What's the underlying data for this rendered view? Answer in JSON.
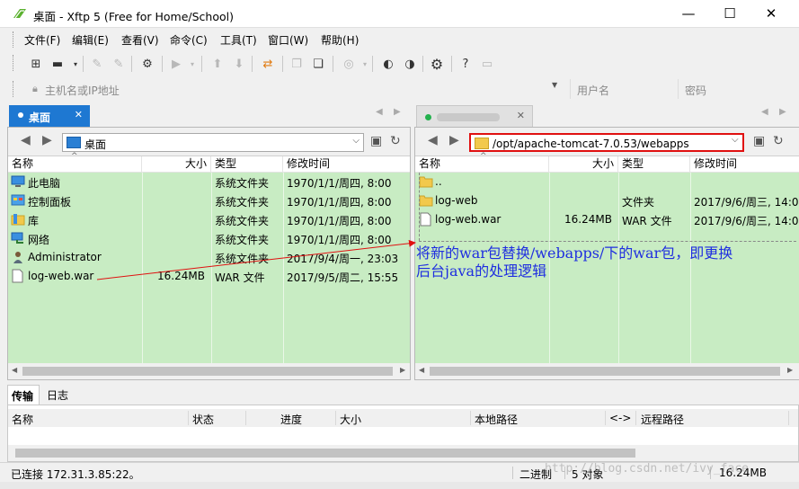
{
  "window": {
    "title": "桌面 - Xftp 5 (Free for Home/School)",
    "minimize": "—",
    "maximize": "☐",
    "close": "✕"
  },
  "menu": [
    "文件(F)",
    "编辑(E)",
    "查看(V)",
    "命令(C)",
    "工具(T)",
    "窗口(W)",
    "帮助(H)"
  ],
  "addressbar": {
    "host_placeholder": "主机名或IP地址",
    "user_placeholder": "用户名",
    "password_placeholder": "密码"
  },
  "left": {
    "tab_label": "桌面",
    "path": "桌面",
    "columns": {
      "name": "名称",
      "size": "大小",
      "type": "类型",
      "modified": "修改时间"
    },
    "files": [
      {
        "name": "此电脑",
        "size": "",
        "type": "系统文件夹",
        "modified": "1970/1/1/周四, 8:00",
        "icon": "computer-icon"
      },
      {
        "name": "控制面板",
        "size": "",
        "type": "系统文件夹",
        "modified": "1970/1/1/周四, 8:00",
        "icon": "control-panel-icon"
      },
      {
        "name": "库",
        "size": "",
        "type": "系统文件夹",
        "modified": "1970/1/1/周四, 8:00",
        "icon": "library-icon"
      },
      {
        "name": "网络",
        "size": "",
        "type": "系统文件夹",
        "modified": "1970/1/1/周四, 8:00",
        "icon": "network-icon"
      },
      {
        "name": "Administrator",
        "size": "",
        "type": "系统文件夹",
        "modified": "2017/9/4/周一, 23:03",
        "icon": "user-icon"
      },
      {
        "name": "log-web.war",
        "size": "16.24MB",
        "type": "WAR 文件",
        "modified": "2017/9/5/周二, 15:55",
        "icon": "file-icon"
      }
    ]
  },
  "right": {
    "path": "/opt/apache-tomcat-7.0.53/webapps",
    "columns": {
      "name": "名称",
      "size": "大小",
      "type": "类型",
      "modified": "修改时间"
    },
    "files": [
      {
        "name": "..",
        "size": "",
        "type": "",
        "modified": "",
        "icon": "folder-icon"
      },
      {
        "name": "log-web",
        "size": "",
        "type": "文件夹",
        "modified": "2017/9/6/周三, 14:0",
        "icon": "folder-icon"
      },
      {
        "name": "log-web.war",
        "size": "16.24MB",
        "type": "WAR 文件",
        "modified": "2017/9/6/周三, 14:0",
        "icon": "file-icon"
      }
    ]
  },
  "annotation": {
    "line1": "将新的war包替换/webapps/下的war包，即更换",
    "line2": "后台java的处理逻辑",
    "color": "#1f2ee0"
  },
  "bottom": {
    "tab_transfer": "传输",
    "tab_log": "日志",
    "columns": [
      "名称",
      "状态",
      "进度",
      "大小",
      "本地路径",
      "<->",
      "远程路径"
    ]
  },
  "status": {
    "connected": "已连接 172.31.3.85:22。",
    "mode": "二进制",
    "objects": "5 对象",
    "size": "16.24MB"
  },
  "watermark": "http://blog.csdn.net/ivy_face",
  "colors": {
    "selection_green": "#c8ecc3",
    "tab_blue": "#1e78d2",
    "highlight_red": "#e01010"
  }
}
